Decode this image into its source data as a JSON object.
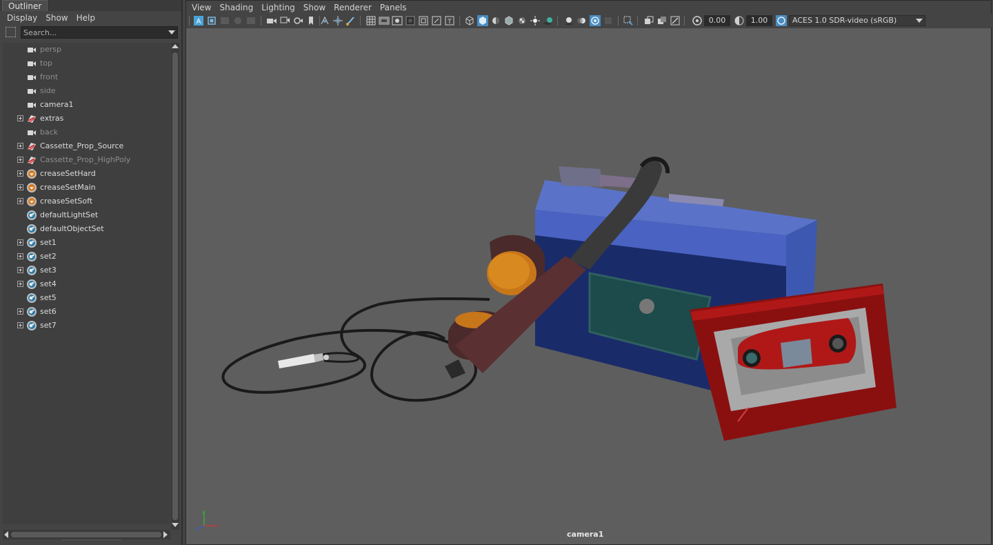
{
  "outliner": {
    "tab_label": "Outliner",
    "menu": [
      "Display",
      "Show",
      "Help"
    ],
    "search_placeholder": "Search...",
    "items": [
      {
        "label": "persp",
        "icon": "camera-icon",
        "dim": true,
        "expandable": false
      },
      {
        "label": "top",
        "icon": "camera-icon",
        "dim": true,
        "expandable": false
      },
      {
        "label": "front",
        "icon": "camera-icon",
        "dim": true,
        "expandable": false
      },
      {
        "label": "side",
        "icon": "camera-icon",
        "dim": true,
        "expandable": false
      },
      {
        "label": "camera1",
        "icon": "camera-icon",
        "dim": false,
        "expandable": false
      },
      {
        "label": "extras",
        "icon": "transform-group-icon",
        "dim": false,
        "expandable": true
      },
      {
        "label": "back",
        "icon": "camera-icon",
        "dim": true,
        "expandable": false
      },
      {
        "label": "Cassette_Prop_Source",
        "icon": "transform-group-icon",
        "dim": false,
        "expandable": true
      },
      {
        "label": "Cassette_Prop_HighPoly",
        "icon": "transform-group-icon",
        "dim": true,
        "expandable": true
      },
      {
        "label": "creaseSetHard",
        "icon": "crease-set-icon",
        "dim": false,
        "expandable": true
      },
      {
        "label": "creaseSetMain",
        "icon": "crease-set-icon",
        "dim": false,
        "expandable": true
      },
      {
        "label": "creaseSetSoft",
        "icon": "crease-set-icon",
        "dim": false,
        "expandable": true
      },
      {
        "label": "defaultLightSet",
        "icon": "object-set-icon",
        "dim": false,
        "expandable": false
      },
      {
        "label": "defaultObjectSet",
        "icon": "object-set-icon",
        "dim": false,
        "expandable": false
      },
      {
        "label": "set1",
        "icon": "object-set-icon",
        "dim": false,
        "expandable": true
      },
      {
        "label": "set2",
        "icon": "object-set-icon",
        "dim": false,
        "expandable": true
      },
      {
        "label": "set3",
        "icon": "object-set-icon",
        "dim": false,
        "expandable": true
      },
      {
        "label": "set4",
        "icon": "object-set-icon",
        "dim": false,
        "expandable": true
      },
      {
        "label": "set5",
        "icon": "object-set-icon",
        "dim": false,
        "expandable": false
      },
      {
        "label": "set6",
        "icon": "object-set-icon",
        "dim": false,
        "expandable": true
      },
      {
        "label": "set7",
        "icon": "object-set-icon",
        "dim": false,
        "expandable": true
      }
    ]
  },
  "viewport": {
    "menu": [
      "View",
      "Shading",
      "Lighting",
      "Show",
      "Renderer",
      "Panels"
    ],
    "exposure_value": "0.00",
    "gamma_value": "1.00",
    "color_space": "ACES 1.0 SDR-video (sRGB)",
    "camera_label": "camera1"
  },
  "colors": {
    "accent": "#5285a6",
    "viewport_background": "#5e5e5e",
    "panel_background": "#444444"
  }
}
